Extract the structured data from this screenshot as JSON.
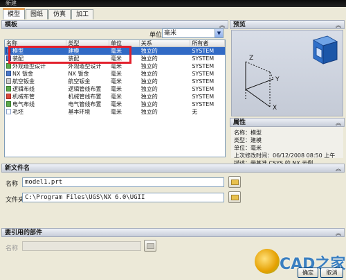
{
  "titlebar": {
    "title": "新建"
  },
  "tabs": [
    {
      "label": "模型"
    },
    {
      "label": "图纸"
    },
    {
      "label": "仿真"
    },
    {
      "label": "加工"
    }
  ],
  "templates_panel": {
    "header": "模板",
    "unit_label": "单位",
    "unit_value": "毫米",
    "columns": [
      "名称",
      "类型",
      "单位",
      "关系",
      "所有者"
    ],
    "rows": [
      {
        "icon": "model-icon",
        "name": "模型",
        "type": "建模",
        "unit": "毫米",
        "relation": "独立的",
        "owner": "SYSTEM",
        "selected": true
      },
      {
        "icon": "model-icon",
        "name": "装配",
        "type": "装配",
        "unit": "毫米",
        "relation": "独立的",
        "owner": "SYSTEM"
      },
      {
        "icon": "shape-design-icon",
        "name": "外观造型设计",
        "type": "外观造型设计",
        "unit": "毫米",
        "relation": "独立的",
        "owner": "SYSTEM"
      },
      {
        "icon": "nx-sheetmetal-icon",
        "name": "NX 钣金",
        "type": "NX 钣金",
        "unit": "毫米",
        "relation": "独立的",
        "owner": "SYSTEM"
      },
      {
        "icon": "aero-sheetmetal-icon",
        "name": "航空钣金",
        "type": "航空钣金",
        "unit": "毫米",
        "relation": "独立的",
        "owner": "SYSTEM"
      },
      {
        "icon": "logical-routing-icon",
        "name": "逻辑布线",
        "type": "逻辑管线布置",
        "unit": "毫米",
        "relation": "独立的",
        "owner": "SYSTEM"
      },
      {
        "icon": "mechanical-routing-icon",
        "name": "机械布管",
        "type": "机械管线布置",
        "unit": "毫米",
        "relation": "独立的",
        "owner": "SYSTEM"
      },
      {
        "icon": "electrical-routing-icon",
        "name": "电气布线",
        "type": "电气管线布置",
        "unit": "毫米",
        "relation": "独立的",
        "owner": "SYSTEM"
      },
      {
        "icon": "blank-doc-icon",
        "name": "毛坯",
        "type": "基本环境",
        "unit": "毫米",
        "relation": "独立的",
        "owner": "无"
      }
    ]
  },
  "preview_panel": {
    "header": "预览",
    "axis_x": "X",
    "axis_y": "Y",
    "axis_z": "Z"
  },
  "properties_panel": {
    "header": "属性",
    "lines": [
      "名称：模型",
      "类型：建模",
      "单位：毫米",
      "上次修改时间：06/12/2008 08:50 上午",
      "描述：带基准 CSYS 的 NX 示例"
    ]
  },
  "new_file_panel": {
    "header": "新文件名",
    "name_label": "名称",
    "name_value": "model1.prt",
    "folder_label": "文件夹",
    "folder_value": "C:\\Program Files\\UGS\\NX 6.0\\UGII"
  },
  "referenced_parts_panel": {
    "header": "要引用的部件",
    "name_label": "名称",
    "name_value": ""
  },
  "buttons": {
    "ok": "确定",
    "cancel": "取消"
  },
  "watermark": {
    "text": "CAD之家"
  }
}
